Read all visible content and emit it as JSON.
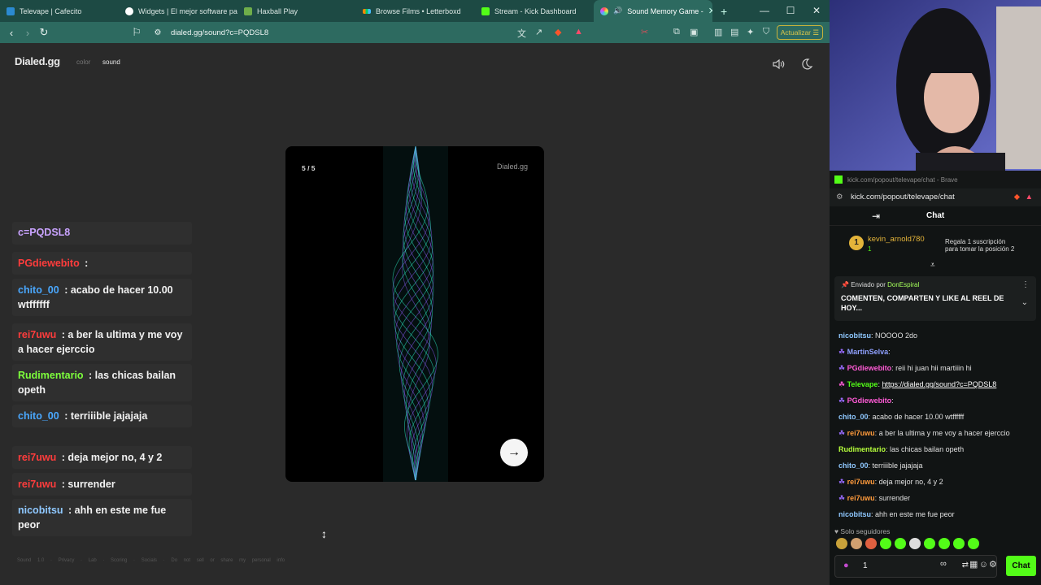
{
  "colors": {
    "accent_kick": "#53fc18",
    "browser_teal": "#2d6a60",
    "card_bg": "#000000"
  },
  "tabs": [
    {
      "label": "Televape | Cafecito",
      "icon": "cafecito-icon"
    },
    {
      "label": "Widgets | El mejor software par",
      "icon": "widgets-icon"
    },
    {
      "label": "Haxball Play",
      "icon": "haxball-icon"
    },
    {
      "label": "Browse Films • Letterboxd",
      "icon": "letterboxd-icon"
    },
    {
      "label": "Stream - Kick Dashboard",
      "icon": "kick-icon"
    },
    {
      "label": "Sound Memory Game -",
      "icon": "dialed-icon"
    }
  ],
  "browser": {
    "url": "dialed.gg/sound?c=PQDSL8",
    "update_label": "Actualizar"
  },
  "page": {
    "brand": "Dialed.gg",
    "nav_color": "color",
    "nav_sound": "sound",
    "card": {
      "counter": "5 / 5",
      "brand": "Dialed.gg",
      "next": "→"
    },
    "footer": "Sound 1.0 · Privacy · Lab · Scoring · Socials · Do not sell or share my personal info"
  },
  "overlay": {
    "partial": "c=PQDSL8",
    "messages": [
      {
        "user": "PGdiewebito",
        "text": "",
        "color": "#ff3c3c"
      },
      {
        "user": "chito_00",
        "text": "acabo de hacer 10.00 wtffffff",
        "color": "#4aa8ff"
      },
      {
        "user": "rei7uwu",
        "text": "a ber la ultima y me voy a hacer ejerccio",
        "color": "#ff3c3c"
      },
      {
        "user": "Rudimentario",
        "text": "las chicas bailan opeth",
        "color": "#7dff3c"
      },
      {
        "user": "chito_00",
        "text": "terriiible jajajaja",
        "color": "#4aa8ff"
      },
      {
        "user": "rei7uwu",
        "text": "deja mejor no, 4 y 2",
        "color": "#ff3c3c"
      },
      {
        "user": "rei7uwu",
        "text": "surrender",
        "color": "#ff3c3c"
      },
      {
        "user": "nicobitsu",
        "text": "ahh en este me fue peor",
        "color": "#8fc8ff"
      }
    ]
  },
  "kick": {
    "window_title": "kick.com/popout/televape/chat - Brave",
    "url": "kick.com/popout/televape/chat",
    "header": "Chat",
    "sub_user": "kevin_arnold780",
    "sub_count": "1",
    "gift_text_1": "Regala 1 suscripción",
    "gift_text_2": "para tomar la posición 2",
    "pinned_by_label": "Enviado por",
    "pinned_by_user": "DonEspiral",
    "pinned_body": "COMENTEN, COMPARTEN Y LIKE AL REEL DE HOY...",
    "messages": [
      {
        "user": "nicobitsu",
        "text": "NOOOO 2do",
        "color": "#8fc8ff"
      },
      {
        "user": "MartinSelva",
        "text": "",
        "color": "#8fa0ff"
      },
      {
        "user": "PGdiewebito",
        "text": "reii hi juan hii martiiin hi",
        "color": "#ff5bd6"
      },
      {
        "user": "Televape",
        "text": "https://dialed.gg/sound?c=PQDSL8",
        "color": "#53fc18"
      },
      {
        "user": "PGdiewebito",
        "text": "",
        "color": "#ff5bd6"
      },
      {
        "user": "chito_00",
        "text": "acabo de hacer 10.00 wtffffff",
        "color": "#8fc8ff"
      },
      {
        "user": "rei7uwu",
        "text": "a ber la ultima y me voy a hacer ejerccio",
        "color": "#ff9b3c"
      },
      {
        "user": "Rudimentario",
        "text": "las chicas bailan opeth",
        "color": "#b6ff3c"
      },
      {
        "user": "chito_00",
        "text": "terriiible jajajaja",
        "color": "#8fc8ff"
      },
      {
        "user": "rei7uwu",
        "text": "deja mejor no, 4 y 2",
        "color": "#ff9b3c"
      },
      {
        "user": "rei7uwu",
        "text": "surrender",
        "color": "#ff9b3c"
      },
      {
        "user": "nicobitsu",
        "text": "ahh en este me fue peor",
        "color": "#8fc8ff"
      }
    ],
    "followers_only": "Solo seguidores",
    "input_value": "1",
    "chat_button": "Chat"
  }
}
